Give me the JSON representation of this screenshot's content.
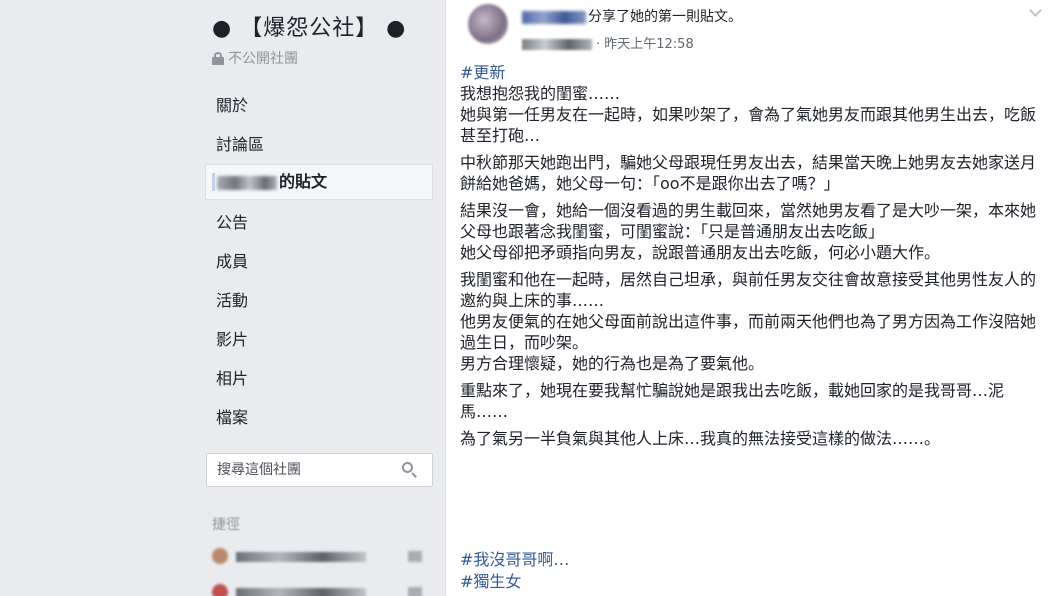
{
  "sidebar": {
    "group_title": "● 【爆怨公社】 ●",
    "privacy": "不公開社團",
    "nav_items": [
      {
        "label": "關於"
      },
      {
        "label": "討論區"
      },
      {
        "label": "的貼文",
        "active": true
      },
      {
        "label": "公告"
      },
      {
        "label": "成員"
      },
      {
        "label": "活動"
      },
      {
        "label": "影片"
      },
      {
        "label": "相片"
      },
      {
        "label": "檔案"
      }
    ],
    "search_placeholder": "搜尋這個社團",
    "shortcuts_label": "捷徑"
  },
  "post": {
    "action_text": "分享了她的第一則貼文。",
    "timestamp": "· 昨天上午12:58",
    "top_hashtag": "#更新",
    "paragraphs": [
      [
        "我想抱怨我的閨蜜……",
        "她與第一任男友在一起時，如果吵架了，會為了氣她男友而跟其他男生出去，吃飯甚至打砲…"
      ],
      [
        "中秋節那天她跑出門，騙她父母跟現任男友出去，結果當天晚上她男友去她家送月餅給她爸媽，她父母一句：「oo不是跟你出去了嗎？」"
      ],
      [
        "結果沒一會，她給一個沒看過的男生載回來，當然她男友看了是大吵一架，本來她父母也跟著念我閨蜜，可閨蜜說：「只是普通朋友出去吃飯」",
        "她父母卻把矛頭指向男友，說跟普通朋友出去吃飯，何必小題大作。"
      ],
      [
        "我閨蜜和他在一起時，居然自己坦承，與前任男友交往會故意接受其他男性友人的邀約與上床的事……",
        "他男友便氣的在她父母面前說出這件事，而前兩天他們也為了男方因為工作沒陪她過生日，而吵架。",
        "男方合理懷疑，她的行為也是為了要氣他。"
      ],
      [
        "重點來了，她現在要我幫忙騙說她是跟我出去吃飯，載她回家的是我哥哥…泥馬……"
      ],
      [
        "為了氣另一半負氣與其他人上床…我真的無法接受這樣的做法……。"
      ]
    ],
    "bottom_hashtags": [
      "#我沒哥哥啊…",
      "#獨生女"
    ]
  },
  "colors": {
    "page_bg": "#e9ebee",
    "link": "#365899",
    "text": "#1d2129",
    "muted": "#90949c"
  }
}
